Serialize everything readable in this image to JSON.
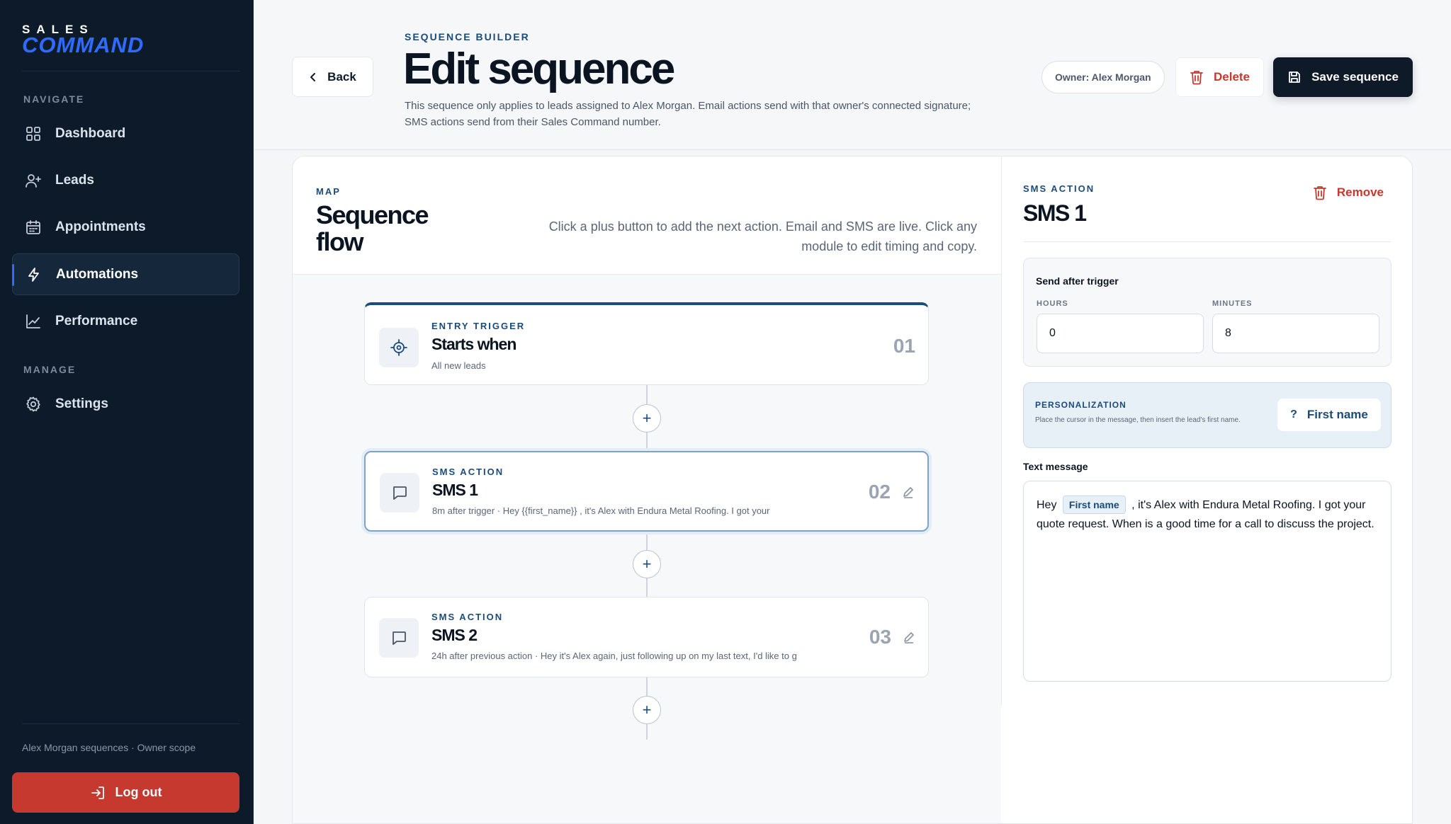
{
  "brand": {
    "top": "SALES",
    "bottom": "COMMAND"
  },
  "sidebar": {
    "navigate_label": "NAVIGATE",
    "manage_label": "MANAGE",
    "items": [
      {
        "label": "Dashboard",
        "icon": "grid-icon"
      },
      {
        "label": "Leads",
        "icon": "user-plus-icon"
      },
      {
        "label": "Appointments",
        "icon": "calendar-icon"
      },
      {
        "label": "Automations",
        "icon": "bolt-icon",
        "active": true
      },
      {
        "label": "Performance",
        "icon": "chart-line-icon"
      }
    ],
    "settings_label": "Settings",
    "footer_text": "Alex Morgan sequences · Owner scope",
    "logout_label": "Log out"
  },
  "header": {
    "back_label": "Back",
    "eyebrow": "SEQUENCE BUILDER",
    "title": "Edit sequence",
    "description": "This sequence only applies to leads assigned to Alex Morgan. Email actions send with that owner's connected signature; SMS actions send from their Sales Command number.",
    "owner_pill": "Owner: Alex Morgan",
    "delete_label": "Delete",
    "save_label": "Save sequence"
  },
  "map": {
    "eyebrow": "MAP",
    "title": "Sequence flow",
    "hint": "Click a plus button to add the next action. Email and SMS are live. Click any module to edit timing and copy.",
    "plus": "+",
    "nodes": [
      {
        "eyebrow": "ENTRY TRIGGER",
        "title": "Starts when",
        "sub": "All new leads",
        "num": "01"
      },
      {
        "eyebrow": "SMS ACTION",
        "title": "SMS 1",
        "sub": "8m after trigger · Hey {{first_name}} , it's Alex with Endura Metal Roofing. I got your",
        "num": "02"
      },
      {
        "eyebrow": "SMS ACTION",
        "title": "SMS 2",
        "sub": "24h after previous action · Hey it's Alex again, just following up on my last text, I'd like to g",
        "num": "03"
      }
    ]
  },
  "editor": {
    "eyebrow": "SMS ACTION",
    "title": "SMS 1",
    "remove_label": "Remove",
    "timing_label": "Send after trigger",
    "hours_label": "HOURS",
    "hours_value": "0",
    "minutes_label": "MINUTES",
    "minutes_value": "8",
    "personalization_title": "PERSONALIZATION",
    "personalization_hint": "Place the cursor in the message, then insert the lead's first name.",
    "first_name_button": "First name",
    "message_label": "Text message",
    "message_pre": "Hey",
    "message_token": "First name",
    "message_post": ", it's Alex with Endura Metal Roofing. I got your quote request. When is a good time for a call to discuss the project."
  },
  "colors": {
    "sidebar_bg": "#0c1a2a",
    "accent": "#1b4b7a",
    "brand_blue": "#2f6bff",
    "danger": "#c5392f",
    "primary_dark": "#0e1a28"
  }
}
